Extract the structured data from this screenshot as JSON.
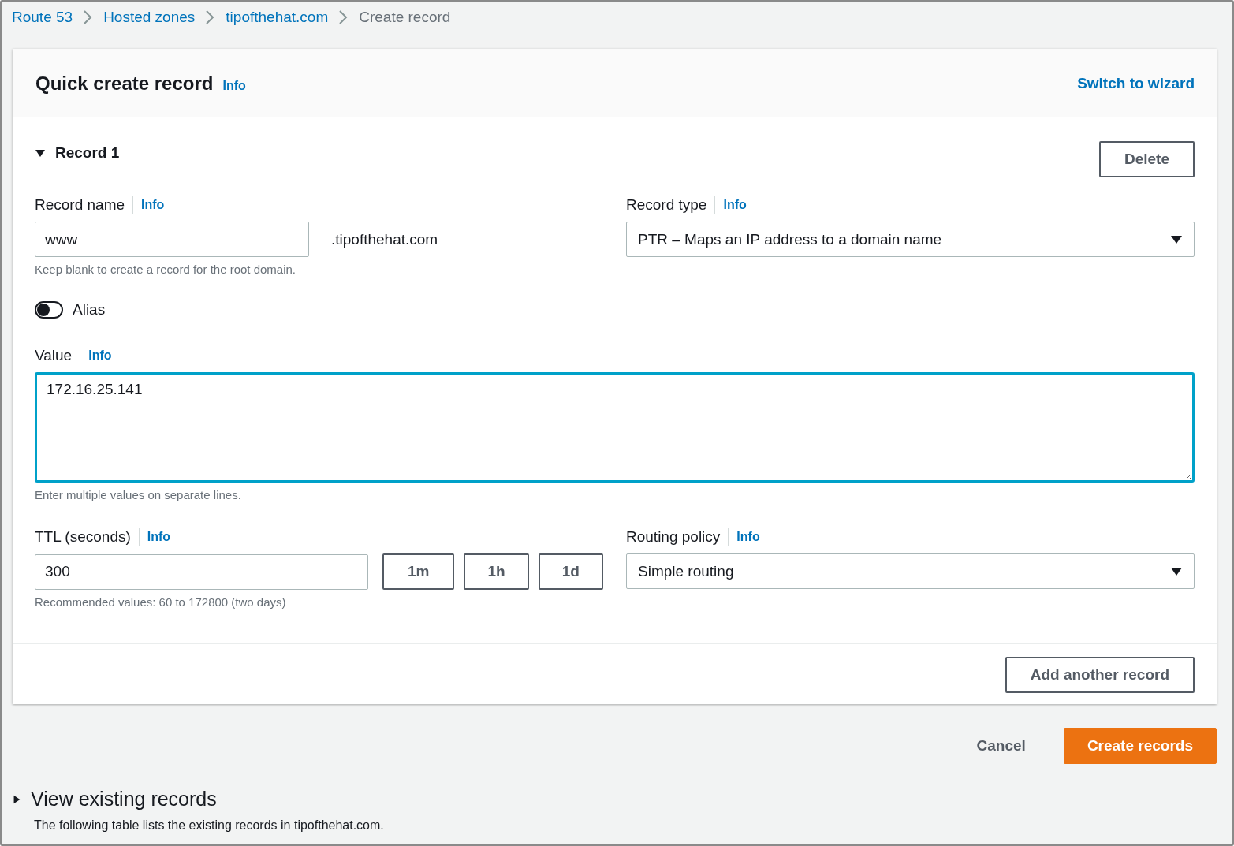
{
  "breadcrumbs": [
    {
      "label": "Route 53",
      "link": true
    },
    {
      "label": "Hosted zones",
      "link": true
    },
    {
      "label": "tipofthehat.com",
      "link": true
    },
    {
      "label": "Create record",
      "link": false
    }
  ],
  "card": {
    "title": "Quick create record",
    "info": "Info",
    "switch_link": "Switch to wizard"
  },
  "record": {
    "title": "Record 1",
    "expanded": true,
    "delete_button": "Delete",
    "record_name": {
      "label": "Record name",
      "info": "Info",
      "value": "www",
      "suffix": ".tipofthehat.com",
      "hint": "Keep blank to create a record for the root domain."
    },
    "record_type": {
      "label": "Record type",
      "info": "Info",
      "value": "PTR – Maps an IP address to a domain name"
    },
    "alias": {
      "label": "Alias",
      "on": false
    },
    "value": {
      "label": "Value",
      "info": "Info",
      "value": "172.16.25.141",
      "hint": "Enter multiple values on separate lines."
    },
    "ttl": {
      "label": "TTL (seconds)",
      "info": "Info",
      "value": "300",
      "presets": [
        "1m",
        "1h",
        "1d"
      ],
      "hint": "Recommended values: 60 to 172800 (two days)"
    },
    "routing_policy": {
      "label": "Routing policy",
      "info": "Info",
      "value": "Simple routing"
    }
  },
  "add_button": "Add another record",
  "actions": {
    "cancel": "Cancel",
    "create": "Create records"
  },
  "existing": {
    "title": "View existing records",
    "expanded": false,
    "description": "The following table lists the existing records in tipofthehat.com."
  }
}
